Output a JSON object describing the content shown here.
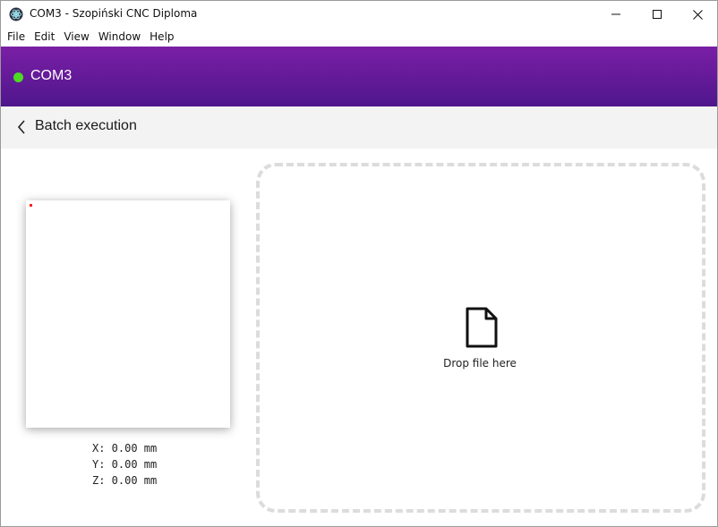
{
  "window": {
    "title": "COM3 - Szopiński CNC Diploma",
    "controls": {
      "minimize_icon": "minimize-icon",
      "maximize_icon": "maximize-icon",
      "close_icon": "close-icon"
    }
  },
  "menu": {
    "items": [
      {
        "label": "File"
      },
      {
        "label": "Edit"
      },
      {
        "label": "View"
      },
      {
        "label": "Window"
      },
      {
        "label": "Help"
      }
    ]
  },
  "header": {
    "connection_label": "COM3",
    "status": "connected",
    "status_color": "#4cdb22",
    "gradient_colors": [
      "#7a1fa6",
      "#4f168c"
    ]
  },
  "subheader": {
    "back_icon": "chevron-left-icon",
    "title": "Batch execution"
  },
  "preview": {
    "marker_color": "#ff2020"
  },
  "coordinates": {
    "x": "X: 0.00 mm",
    "y": "Y: 0.00 mm",
    "z": "Z: 0.00 mm"
  },
  "dropzone": {
    "icon": "file-icon",
    "label": "Drop file here"
  }
}
